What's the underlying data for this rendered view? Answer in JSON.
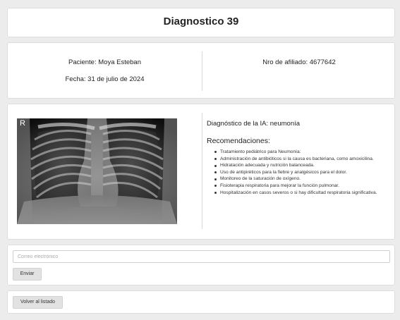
{
  "header": {
    "title": "Diagnostico 39"
  },
  "patient": {
    "name_label": "Paciente: Moya Esteban",
    "date_label": "Fecha: 31 de julio de 2024",
    "affiliate_label": "Nro de afiliado: 4677642"
  },
  "xray": {
    "marker": "R"
  },
  "diagnosis": {
    "label": "Diagnóstico de la IA: neumonía",
    "recommendations_title": "Recomendaciones:",
    "recommendations": [
      "Tratamiento pediátrico para Neumonía:",
      "Administración de antibióticos si la causa es bacteriana, como amoxicilina.",
      "Hidratación adecuada y nutrición balanceada.",
      "Uso de antipiréticos para la fiebre y analgésicos para el dolor.",
      "Monitoreo de la saturación de oxígeno.",
      "Fisioterapia respiratoria para mejorar la función pulmonar.",
      "Hospitalización en casos severos o si hay dificultad respiratoria significativa."
    ]
  },
  "email": {
    "placeholder": "Correo electrónico",
    "value": "",
    "send_label": "Enviar"
  },
  "nav": {
    "back_label": "Volver al listado"
  }
}
